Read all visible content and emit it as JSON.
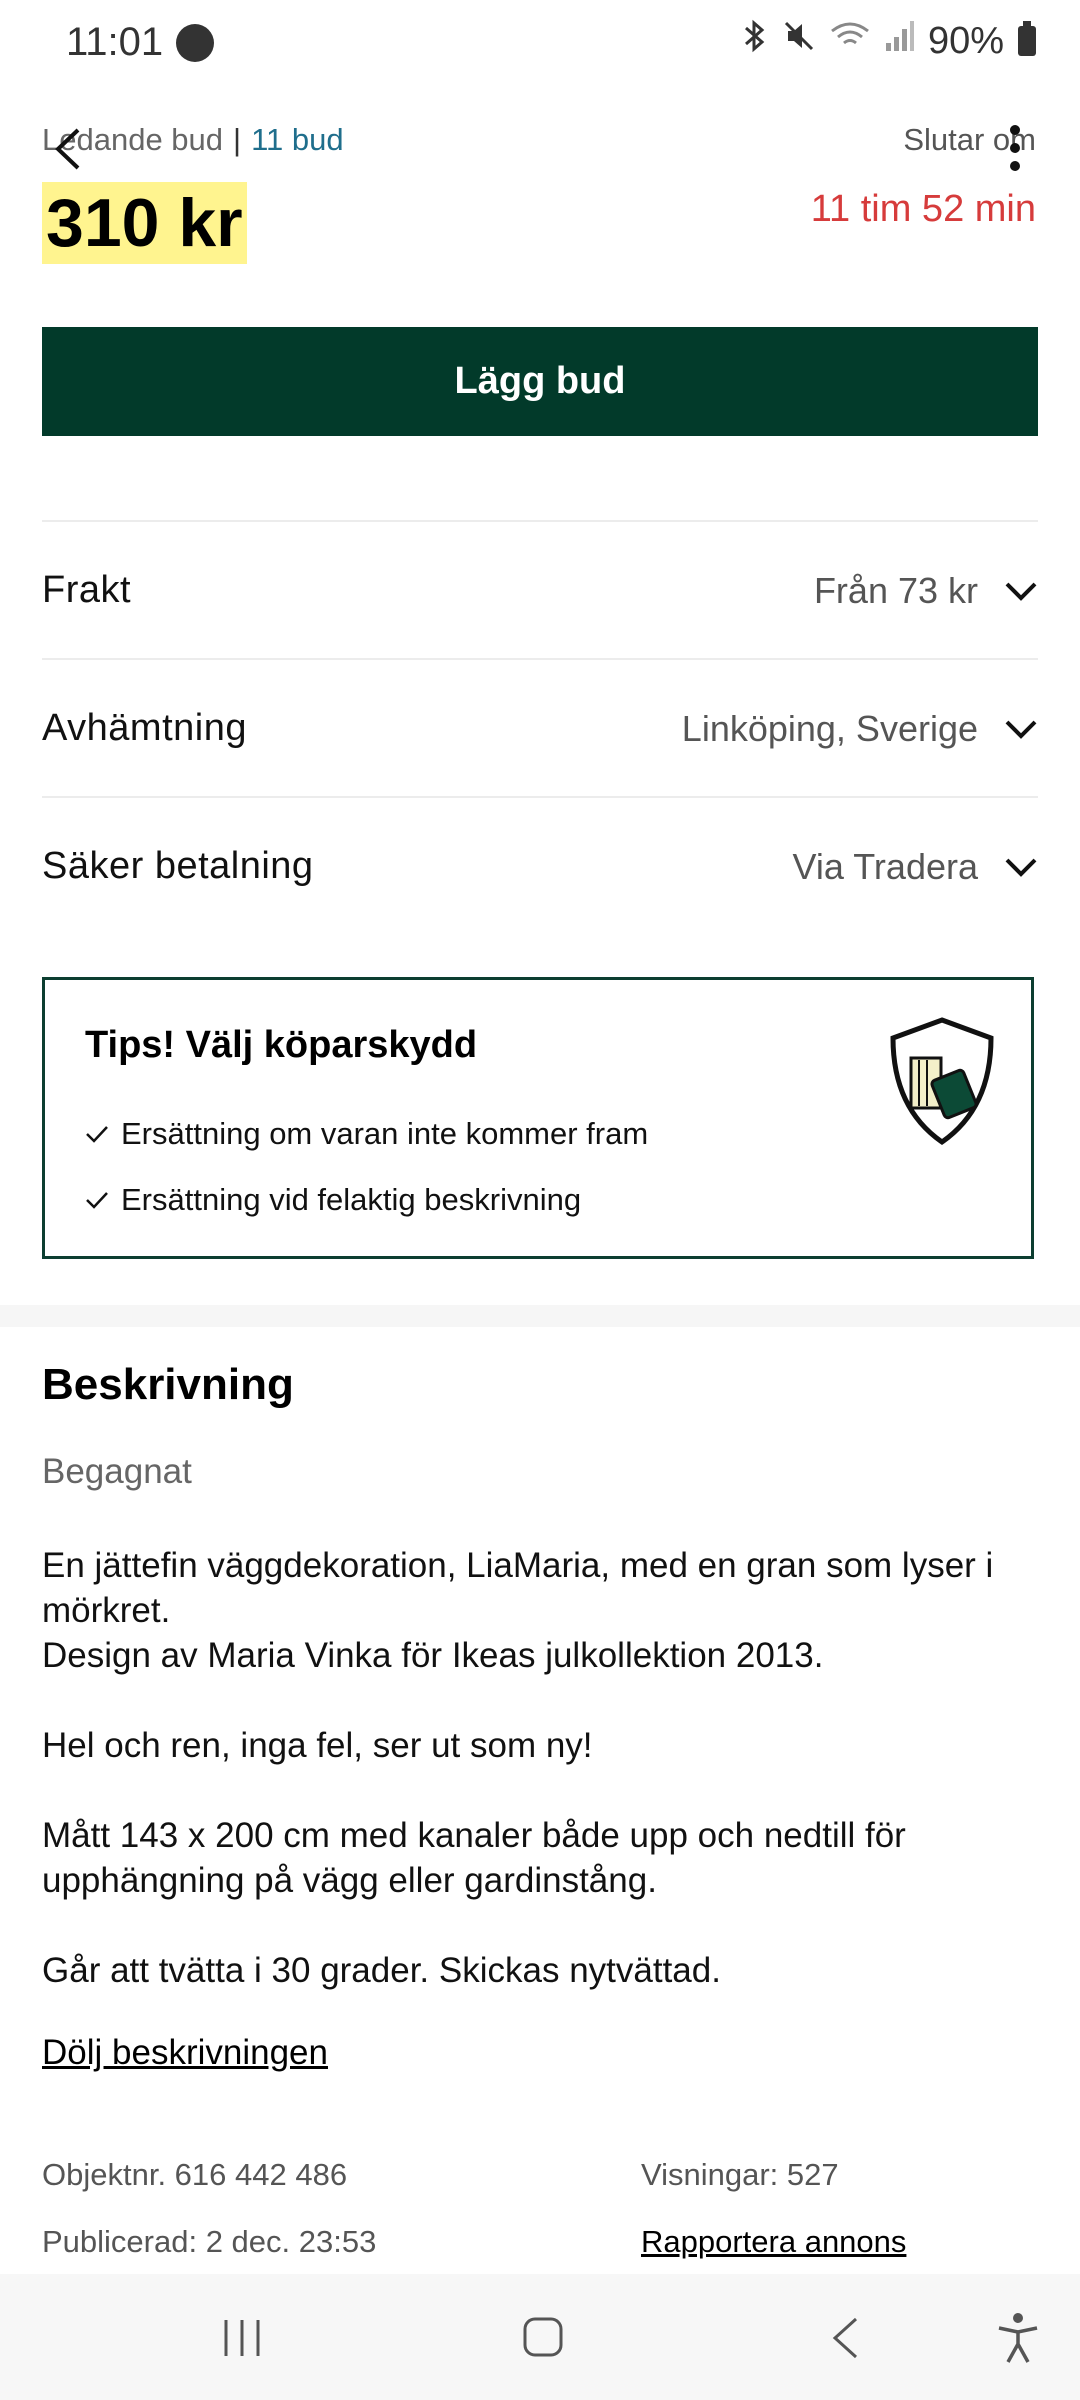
{
  "status_bar": {
    "time": "11:01",
    "battery": "90%"
  },
  "header": {
    "leading_label": "Ledande bud",
    "bids_count": "11 bud",
    "ends_label": "Slutar om",
    "price": "310 kr",
    "time_left": "11 tim 52 min"
  },
  "actions": {
    "bid_button": "Lägg bud"
  },
  "rows": [
    {
      "label": "Frakt",
      "value": "Från 73 kr"
    },
    {
      "label": "Avhämtning",
      "value": "Linköping, Sverige"
    },
    {
      "label": "Säker betalning",
      "value": "Via Tradera"
    }
  ],
  "tips": {
    "title": "Tips! Välj köparskydd",
    "items": [
      "Ersättning om varan inte kommer fram",
      "Ersättning vid felaktig beskrivning"
    ]
  },
  "description": {
    "title": "Beskrivning",
    "condition": "Begagnat",
    "text": "En jättefin väggdekoration, LiaMaria, med en gran som lyser i mörkret.\nDesign av Maria Vinka för Ikeas julkollektion 2013.\n\nHel och ren, inga fel, ser ut som ny!\n\nMått 143 x 200 cm med kanaler både upp och nedtill för upphängning på vägg eller gardinstång.\n\nGår att tvätta i 30 grader. Skickas nytvättad.",
    "hide_link": "Dölj beskrivningen"
  },
  "meta": {
    "object_number": "Objektnr. 616 442 486",
    "views": "Visningar: 527",
    "published": "Publicerad: 2 dec. 23:53",
    "report_link": "Rapportera annons"
  },
  "colors": {
    "brand_dark_green": "#023a2a",
    "price_highlight": "#fff48f",
    "time_left_red": "#d63b3b",
    "link_blue": "#1f6e8c"
  }
}
